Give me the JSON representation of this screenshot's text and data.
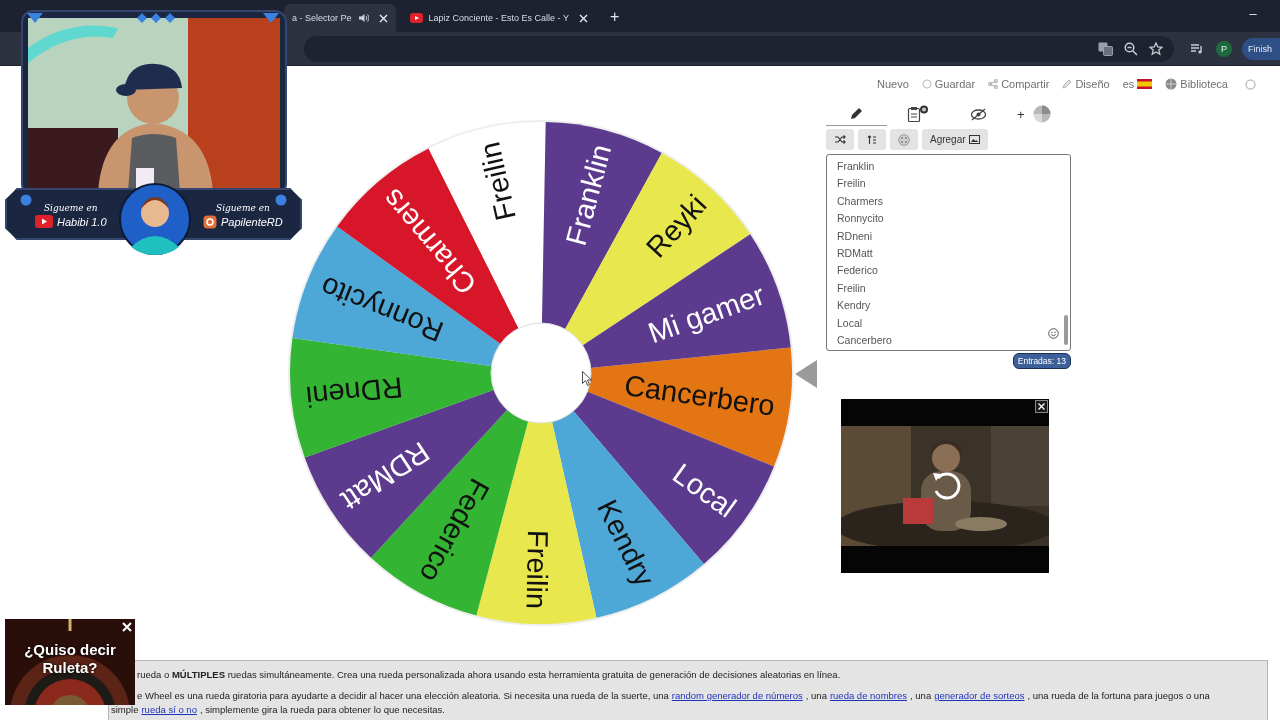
{
  "browser": {
    "tabs": [
      {
        "title": "a - Selector Pe",
        "kind": "plain",
        "audio": true,
        "selected": true
      },
      {
        "title": "Lapiz Conciente - Esto Es Calle - Y",
        "kind": "video",
        "audio": false,
        "selected": false
      }
    ],
    "new_tab": "+",
    "minimize": "–",
    "profile": "P",
    "finish_button": "Finish"
  },
  "nav": [
    {
      "kind": "new",
      "label": "Nuevo"
    },
    {
      "kind": "save",
      "label": "Guardar"
    },
    {
      "kind": "share",
      "label": "Compartir"
    },
    {
      "kind": "design",
      "label": "Diseño"
    },
    {
      "kind": "language",
      "label": "es"
    },
    {
      "kind": "library",
      "label": "Biblioteca"
    }
  ],
  "wheel": {
    "segments": [
      {
        "label": "Cancerbero",
        "color": "#e37612"
      },
      {
        "label": "Local",
        "color": "#5c3b8e"
      },
      {
        "label": "Kendry",
        "color": "#4da8d8"
      },
      {
        "label": "Freilin",
        "color": "#e8e84e"
      },
      {
        "label": "Federico",
        "color": "#33b533"
      },
      {
        "label": "RDMatt",
        "color": "#5c3b8e"
      },
      {
        "label": "RDneni",
        "color": "#33b533"
      },
      {
        "label": "Ronnycito",
        "color": "#4da8d8"
      },
      {
        "label": "Charmers",
        "color": "#d8162a"
      },
      {
        "label": "Freilin",
        "color": "#ffffff"
      },
      {
        "label": "Franklin",
        "color": "#5c3b8e"
      },
      {
        "label": "Reyki",
        "color": "#e8e84e"
      },
      {
        "label": "Mi gamer",
        "color": "#5c3b8e"
      }
    ]
  },
  "panel": {
    "tabs": [
      {
        "kind": "edit",
        "selected": true
      },
      {
        "kind": "results",
        "selected": false
      },
      {
        "kind": "hidden",
        "selected": false
      }
    ],
    "add_label": "+",
    "tools": [
      {
        "kind": "shuffle"
      },
      {
        "kind": "sort"
      },
      {
        "kind": "theme"
      },
      {
        "kind": "add-image",
        "label": "Agregar"
      }
    ],
    "entries": [
      "Franklin",
      "Freilin",
      "Charmers",
      "Ronnycito",
      "RDneni",
      "RDMatt",
      "Federico",
      "Freilin",
      "Kendry",
      "Local",
      "Cancerbero"
    ],
    "count": "Entradas: 13"
  },
  "roulette_ad": {
    "text": "¿Quiso decir Ruleta?"
  },
  "stream_overlay": {
    "social": [
      {
        "kind": "youtube",
        "caption": "Sigueme en",
        "handle": "Habibi 1.0"
      },
      {
        "kind": "instagram",
        "caption": "Sigueme en",
        "handle": "PapilenteRD"
      }
    ]
  },
  "description": {
    "lines": [
      [
        {
          "text": "rueda o **MÚLTIPLES** ruedas simultáneamente. Crea una rueda personalizada ahora usando esta herramienta gratuita de generación de decisiones aleatorias en línea."
        }
      ],
      [
        {
          "text": "e Wheel es una rueda giratoria para ayudarte a decidir al hacer una elección aleatoria. Si necesita una rueda de la suerte, una"
        },
        {
          "text": "random generador de números",
          "link": true
        },
        {
          "text": ", una"
        },
        {
          "text": "rueda de nombres",
          "link": true
        },
        {
          "text": ", una"
        },
        {
          "text": "generador de sorteos",
          "link": true
        },
        {
          "text": ", una rueda de la fortuna para juegos o una"
        }
      ],
      [
        {
          "text": "simple"
        },
        {
          "text": "rueda sí o no",
          "link": true
        },
        {
          "text": ", simplemente gira la rueda para obtener lo que necesitas."
        }
      ]
    ]
  }
}
